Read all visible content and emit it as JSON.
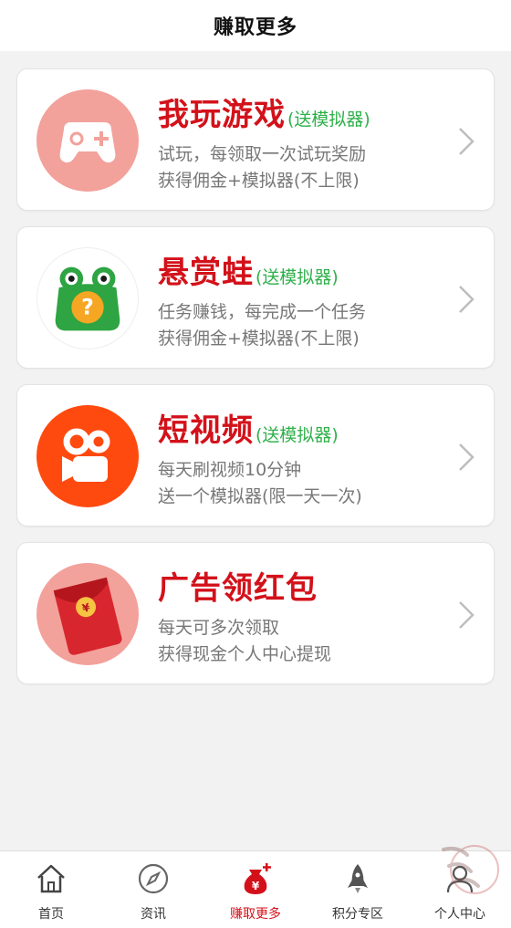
{
  "header": {
    "title": "赚取更多"
  },
  "cards": [
    {
      "title": "我玩游戏",
      "tag": "(送模拟器)",
      "desc1": "试玩，每领取一次试玩奖励",
      "desc2": "获得佣金+模拟器(不上限)",
      "icon": "gamepad-icon"
    },
    {
      "title": "悬赏蛙",
      "tag": "(送模拟器)",
      "desc1": "任务赚钱，每完成一个任务",
      "desc2": "获得佣金+模拟器(不上限)",
      "icon": "frog-icon"
    },
    {
      "title": "短视频",
      "tag": "(送模拟器)",
      "desc1": "每天刷视频10分钟",
      "desc2": "送一个模拟器(限一天一次)",
      "icon": "video-camera-icon"
    },
    {
      "title": "广告领红包",
      "tag": "",
      "desc1": "每天可多次领取",
      "desc2": "获得现金个人中心提现",
      "icon": "red-envelope-icon"
    }
  ],
  "nav": [
    {
      "label": "首页",
      "icon": "home-icon"
    },
    {
      "label": "资讯",
      "icon": "compass-icon"
    },
    {
      "label": "赚取更多",
      "icon": "money-bag-icon",
      "active": true
    },
    {
      "label": "积分专区",
      "icon": "rocket-icon"
    },
    {
      "label": "个人中心",
      "icon": "user-icon"
    }
  ],
  "colors": {
    "title_red": "#d3111a",
    "tag_green": "#2fb04a",
    "desc_gray": "#777777"
  }
}
